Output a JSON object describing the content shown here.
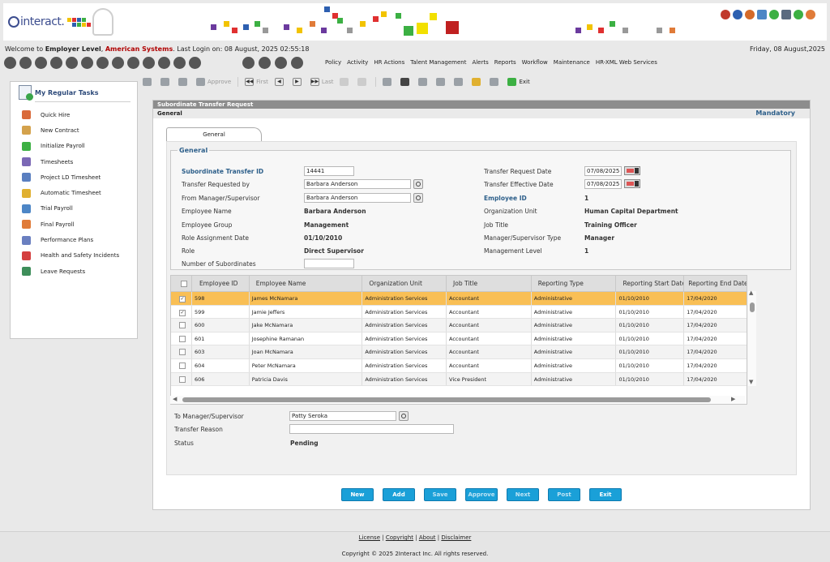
{
  "logo": {
    "text": "interact."
  },
  "welcome": {
    "prefix": "Welcome to ",
    "level": "Employer Level",
    "sep": ", ",
    "company": "American Systems",
    "login": ". Last Login on: 08 August, 2025 02:55:18",
    "date": "Friday, 08 August,2025"
  },
  "menu": [
    "Policy",
    "Activity",
    "HR Actions",
    "Talent Management",
    "Alerts",
    "Reports",
    "Workflow",
    "Maintenance",
    "HR-XML Web Services"
  ],
  "tasks": {
    "title": "My Regular Tasks",
    "items": [
      {
        "label": "Quick Hire",
        "color": "#d96a3a"
      },
      {
        "label": "New Contract",
        "color": "#d4a24c"
      },
      {
        "label": "Initialize Payroll",
        "color": "#3cb043"
      },
      {
        "label": "Timesheets",
        "color": "#7b68b5"
      },
      {
        "label": "Project LD Timesheet",
        "color": "#5a7fc0"
      },
      {
        "label": "Automatic Timesheet",
        "color": "#e0b030"
      },
      {
        "label": "Trial Payroll",
        "color": "#4d86c6"
      },
      {
        "label": "Final Payroll",
        "color": "#e07b39"
      },
      {
        "label": "Performance Plans",
        "color": "#6a7fc0"
      },
      {
        "label": "Health and Safety Incidents",
        "color": "#d43f3f"
      },
      {
        "label": "Leave Requests",
        "color": "#3e8e5a"
      }
    ]
  },
  "toolbar": {
    "approve": "Approve",
    "first_arrow": "◀◀",
    "first": "First",
    "prev": "◀",
    "next": "▶",
    "last_arrow": "▶▶",
    "last": "Last",
    "exit": "Exit"
  },
  "form": {
    "title": "Subordinate Transfer Request",
    "section": "General",
    "mandatory": "Mandatory",
    "tab": "General",
    "legend": "General",
    "fields": {
      "transfer_id_label": "Subordinate Transfer ID",
      "transfer_id_value": "14441",
      "requested_by_label": "Transfer Requested by",
      "requested_by_value": "Barbara Anderson",
      "from_manager_label": "From Manager/Supervisor",
      "from_manager_value": "Barbara Anderson",
      "employee_name_label": "Employee Name",
      "employee_name_value": "Barbara Anderson",
      "employee_group_label": "Employee Group",
      "employee_group_value": "Management",
      "role_date_label": "Role Assignment Date",
      "role_date_value": "01/10/2010",
      "role_label": "Role",
      "role_value": "Direct Supervisor",
      "subordinates_label": "Number of Subordinates",
      "subordinates_value": "",
      "request_date_label": "Transfer Request Date",
      "request_date_value": "07/08/2025",
      "effective_date_label": "Transfer Effective Date",
      "effective_date_value": "07/08/2025",
      "employee_id_label": "Employee ID",
      "employee_id_value": "1",
      "org_unit_label": "Organization Unit",
      "org_unit_value": "Human Capital Department",
      "job_title_label": "Job Title",
      "job_title_value": "Training Officer",
      "mgr_type_label": "Manager/Supervisor Type",
      "mgr_type_value": "Manager",
      "mgmt_level_label": "Management Level",
      "mgmt_level_value": "1"
    }
  },
  "grid": {
    "columns": [
      "Employee ID",
      "Employee Name",
      "Organization Unit",
      "Job Title",
      "Reporting Type",
      "Reporting Start Date",
      "Reporting End Date"
    ],
    "rows": [
      {
        "id": "598",
        "name": "James McNamara",
        "org": "Administration Services",
        "job": "Accountant",
        "type": "Administrative",
        "start": "01/10/2010",
        "end": "17/04/2020",
        "checked": true
      },
      {
        "id": "599",
        "name": "Jamie Jeffers",
        "org": "Administration Services",
        "job": "Accountant",
        "type": "Administrative",
        "start": "01/10/2010",
        "end": "17/04/2020",
        "checked": true
      },
      {
        "id": "600",
        "name": "Jake McNamara",
        "org": "Administration Services",
        "job": "Accountant",
        "type": "Administrative",
        "start": "01/10/2010",
        "end": "17/04/2020",
        "checked": false
      },
      {
        "id": "601",
        "name": "Josephine Ramanan",
        "org": "Administration Services",
        "job": "Accountant",
        "type": "Administrative",
        "start": "01/10/2010",
        "end": "17/04/2020",
        "checked": false
      },
      {
        "id": "603",
        "name": "Joan McNamara",
        "org": "Administration Services",
        "job": "Accountant",
        "type": "Administrative",
        "start": "01/10/2010",
        "end": "17/04/2020",
        "checked": false
      },
      {
        "id": "604",
        "name": "Peter McNamara",
        "org": "Administration Services",
        "job": "Accountant",
        "type": "Administrative",
        "start": "01/10/2010",
        "end": "17/04/2020",
        "checked": false
      },
      {
        "id": "606",
        "name": "Patricia Davis",
        "org": "Administration Services",
        "job": "Vice President",
        "type": "Administrative",
        "start": "01/10/2010",
        "end": "17/04/2020",
        "checked": false
      }
    ]
  },
  "bottom": {
    "to_manager_label": "To Manager/Supervisor",
    "to_manager_value": "Patty Seroka",
    "reason_label": "Transfer Reason",
    "reason_value": "",
    "status_label": "Status",
    "status_value": "Pending"
  },
  "buttons": {
    "new": "New",
    "add": "Add",
    "save": "Save",
    "approve": "Approve",
    "next": "Next",
    "post": "Post",
    "exit": "Exit"
  },
  "footer": {
    "license": "License",
    "copyright_link": "Copyright",
    "about": "About",
    "disclaimer": "Disclaimer",
    "sep": " | ",
    "copyright": "Copyright © 2025 2Interact Inc. All rights reserved."
  }
}
